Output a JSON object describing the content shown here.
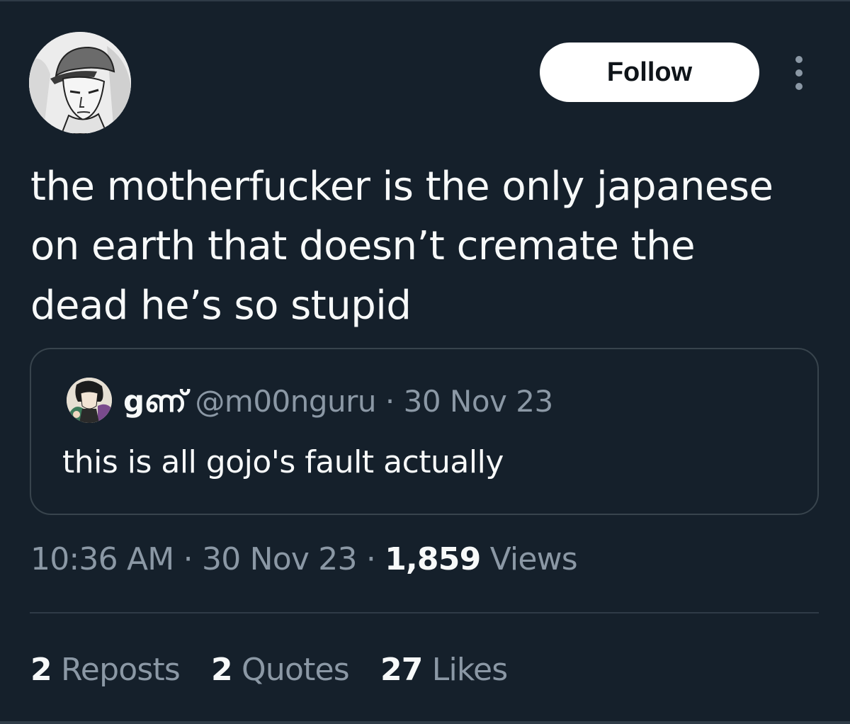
{
  "colors": {
    "background": "#15202b",
    "text_primary": "#f7f9f9",
    "text_secondary": "#8b98a5",
    "border": "#38444d",
    "follow_button_bg": "#ffffff",
    "follow_button_text": "#0f1419"
  },
  "header": {
    "avatar_icon": "user-avatar-icon",
    "follow_label": "Follow",
    "more_icon": "more-vertical-icon"
  },
  "tweet": {
    "text_lines": [
      "the motherfucker is the only japanese",
      "on earth that doesn’t cremate the",
      "dead he’s so stupid"
    ]
  },
  "quote": {
    "avatar_icon": "user-avatar-icon",
    "name": "gണ്",
    "handle": "@m00nguru",
    "separator": "·",
    "date": "30 Nov 23",
    "text": "this is all gojo's fault actually"
  },
  "meta": {
    "time": "10:36 AM",
    "separator": "·",
    "date": "30 Nov 23",
    "views_count": "1,859",
    "views_label": "Views"
  },
  "stats": {
    "reposts_count": "2",
    "reposts_label": "Reposts",
    "quotes_count": "2",
    "quotes_label": "Quotes",
    "likes_count": "27",
    "likes_label": "Likes"
  }
}
